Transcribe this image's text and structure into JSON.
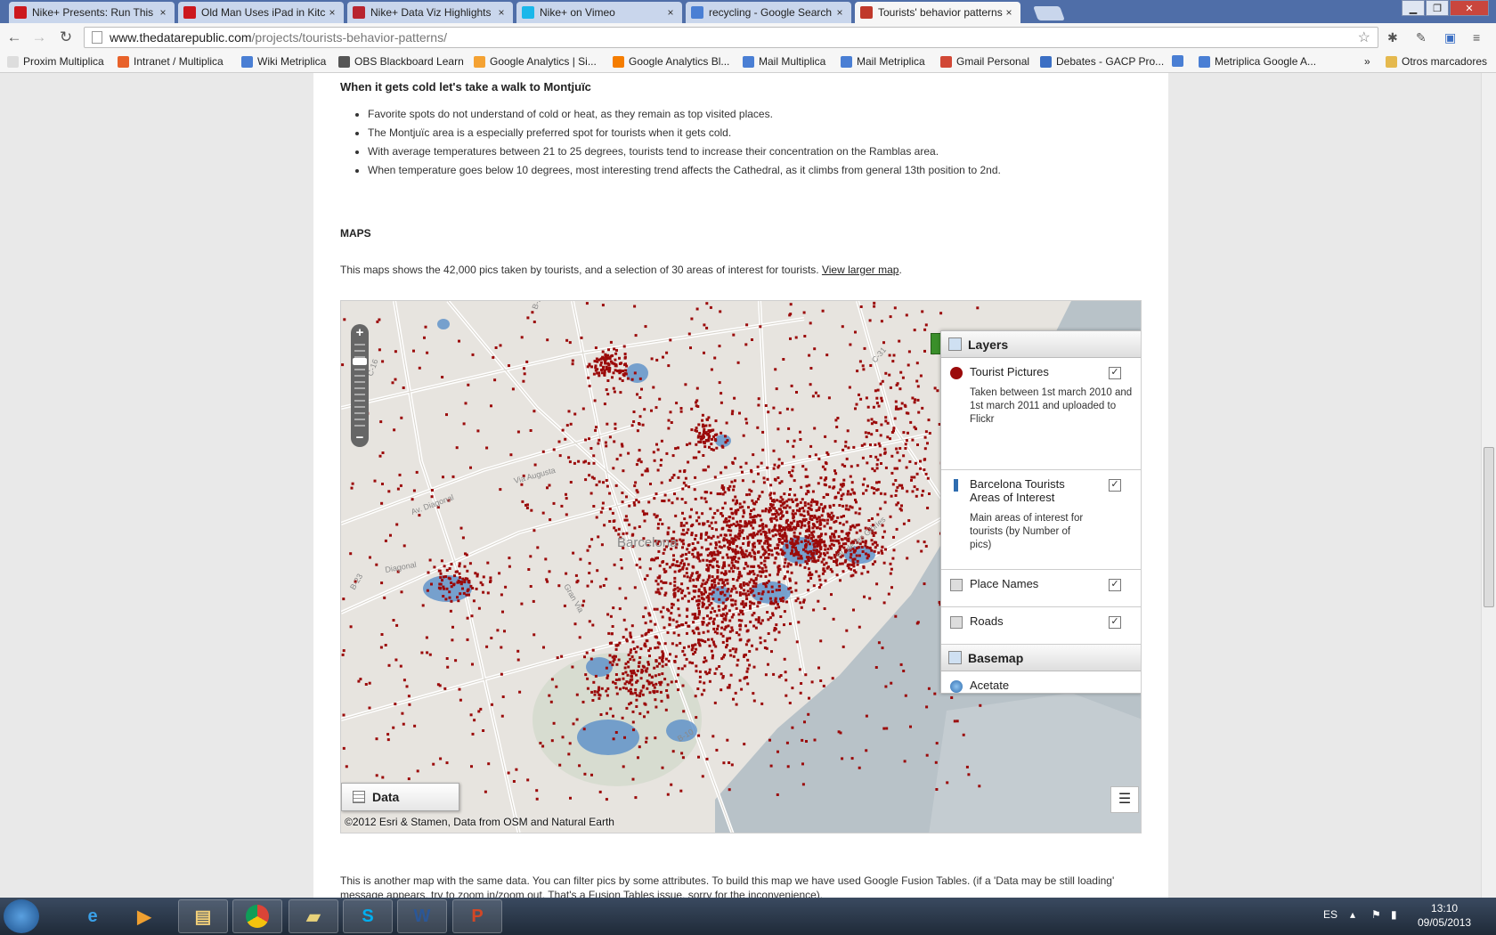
{
  "browser": {
    "tabs": [
      {
        "title": "Nike+ Presents: Run This !",
        "favicon": "youtube-icon",
        "color": "#cc181e"
      },
      {
        "title": "Old Man Uses iPad in Kitc",
        "favicon": "youtube-icon",
        "color": "#cc181e"
      },
      {
        "title": "Nike+ Data Viz Highlights",
        "favicon": "w-icon",
        "color": "#b8242f"
      },
      {
        "title": "Nike+ on Vimeo",
        "favicon": "vimeo-icon",
        "color": "#1ab7ea"
      },
      {
        "title": "recycling - Google Search",
        "favicon": "google-icon",
        "color": "#4a7fd4"
      },
      {
        "title": "Tourists' behavior patterns",
        "favicon": "star-favicon",
        "color": "#c0392b"
      }
    ],
    "url_host": "www.thedatarepublic.com",
    "url_path": "/projects/tourists-behavior-patterns/",
    "bookmarks": [
      {
        "label": "Proxim Multiplica",
        "color": "#dddddd"
      },
      {
        "label": "Intranet / Multiplica",
        "color": "#e8622a"
      },
      {
        "label": "Wiki Metriplica",
        "color": "#4a7fd4"
      },
      {
        "label": "OBS Blackboard Learn",
        "color": "#555555"
      },
      {
        "label": "Google Analytics | Si...",
        "color": "#f4a233"
      },
      {
        "label": "Google Analytics Bl...",
        "color": "#f57d00"
      },
      {
        "label": "Mail Multiplica",
        "color": "#4a7fd4"
      },
      {
        "label": "Mail Metriplica",
        "color": "#4a7fd4"
      },
      {
        "label": "Gmail Personal",
        "color": "#d14836"
      },
      {
        "label": "Debates - GACP Pro...",
        "color": "#3b6fc4"
      },
      {
        "label": "",
        "color": "#4a7fd4"
      },
      {
        "label": "Metriplica Google A...",
        "color": "#4a7fd4"
      }
    ],
    "overflow_label": "»",
    "other_bookmarks": "Otros marcadores"
  },
  "article": {
    "heading": "When it gets cold let's take a walk to Montjuïc",
    "bullets": [
      "Favorite spots do not understand of cold or heat, as they remain as top visited places.",
      "The Montjuïc area is a especially preferred spot for tourists when it gets cold.",
      "With average temperatures between 21 to 25 degrees, tourists tend to increase their concentration on the Ramblas area.",
      "When temperature goes below 10 degrees, most interesting trend affects the Cathedral, as it climbs from general 13th position to 2nd."
    ],
    "maps_heading": "MAPS",
    "maps_text": "This maps shows the 42,000 pics taken by tourists, and a selection of 30 areas of interest for tourists.",
    "maps_link": "View larger map",
    "maps_text_end": ".",
    "bottom_text": "This is another map with the same data. You can filter pics by some attributes. To build this map we have used Google Fusion Tables. (if a 'Data may be still loading' message appears, try to zoom in/zoom out. That's a Fusion Tables issue, sorry for the inconvenience)."
  },
  "map": {
    "city_label": "Barcelona",
    "street_labels": [
      "Via Augusta",
      "Av. Diagonal",
      "Diagonal",
      "Pl. de les Glòries",
      "Gran Via",
      "B-20",
      "B-23",
      "C-16",
      "C-31",
      "B-10"
    ],
    "layers_title": "Layers",
    "layers": [
      {
        "title": "Tourist Pictures",
        "desc": "Taken between 1st march 2010 and 1st march 2011 and uploaded to Flickr",
        "checked": true,
        "icon": "red-dot-icon"
      },
      {
        "title": "Barcelona Tourists Areas of Interest",
        "desc": "Main areas of interest for tourists (by Number of pics)",
        "checked": true,
        "icon": "blue-bar-icon"
      },
      {
        "title": "Place Names",
        "desc": "",
        "checked": true,
        "icon": "grid-icon"
      },
      {
        "title": "Roads",
        "desc": "",
        "checked": true,
        "icon": "grid-icon"
      }
    ],
    "basemap_title": "Basemap",
    "basemap_option": "Acetate",
    "data_button": "Data",
    "attribution": "©2012 Esri & Stamen, Data from OSM and Natural Earth",
    "dot_color": "#9b0a0a",
    "area_color": "#5a8fc8",
    "sea_color": "#b8c2c8"
  },
  "taskbar": {
    "lang": "ES",
    "time": "13:10",
    "date": "09/05/2013"
  }
}
